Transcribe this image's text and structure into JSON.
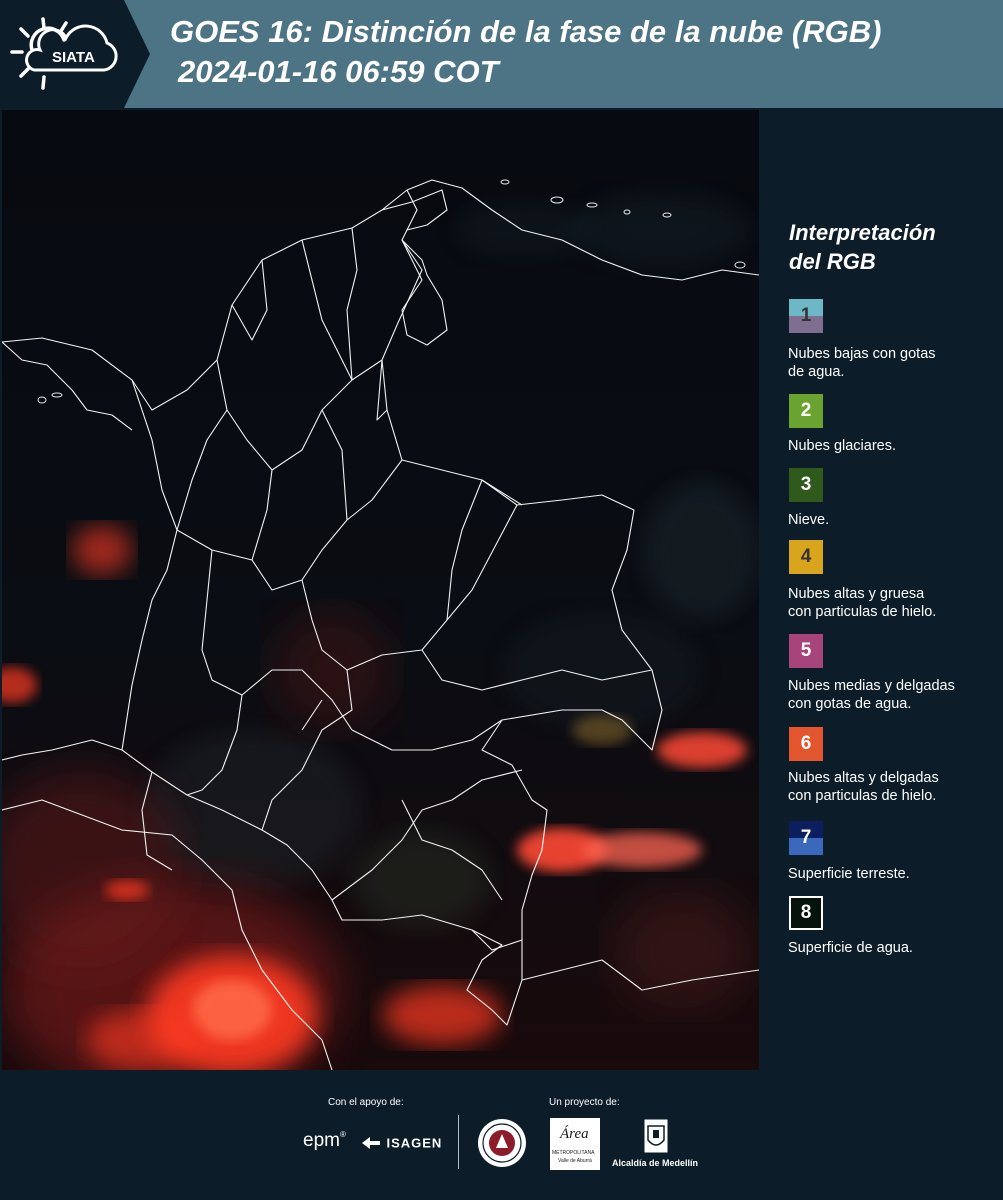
{
  "header": {
    "logo_text": "SIATA",
    "title_line1": "GOES 16: Distinción de la fase de la nube (RGB)",
    "title_line2": "2024-01-16 06:59 COT"
  },
  "legend": {
    "title_line1": "Interpretación",
    "title_line2": "del RGB",
    "items": [
      {
        "number": "1",
        "color_top": "#6cb8c6",
        "color_bottom": "#7e6e90",
        "text_line1": "Nubes bajas con gotas",
        "text_line2": "de agua."
      },
      {
        "number": "2",
        "color": "#6aa330",
        "text_line1": "Nubes glaciares.",
        "text_line2": ""
      },
      {
        "number": "3",
        "color": "#2f5a1c",
        "text_line1": "Nieve.",
        "text_line2": ""
      },
      {
        "number": "4",
        "color": "#d9a51d",
        "text_line1": "Nubes altas y gruesa",
        "text_line2": "con particulas de hielo."
      },
      {
        "number": "5",
        "color": "#a7447b",
        "text_line1": "Nubes medias y delgadas",
        "text_line2": "con gotas de agua."
      },
      {
        "number": "6",
        "color": "#e3552c",
        "text_line1": "Nubes altas y delgadas",
        "text_line2": "con particulas de hielo."
      },
      {
        "number": "7",
        "color_top": "#0c1e5e",
        "color_bottom": "#3a68bd",
        "text_line1": "Superficie terreste.",
        "text_line2": ""
      },
      {
        "number": "8",
        "color": "#06130c",
        "text_line1": "Superficie de agua.",
        "text_line2": ""
      }
    ]
  },
  "footer": {
    "support_label": "Con el apoyo de:",
    "project_label": "Un proyecto de:",
    "epm_text": "epm",
    "isagen_text": "ISAGEN",
    "area_text": "Área",
    "area_sub1": "METROPOLITANA",
    "area_sub2": "Valle de Aburrá",
    "alcaldia_text": "Alcaldía de Medellín"
  },
  "colors": {
    "header_bg": "#4d7484",
    "logo_bg": "#0c1d29",
    "page_bg": "#0c1d29",
    "cloud_red": "#ff3b24",
    "border_white": "#ffffff"
  },
  "icons": [
    "siata-sun-cloud-logo-icon",
    "epm-logo-icon",
    "isagen-logo-icon",
    "university-seal-icon",
    "area-metropolitana-logo-icon",
    "alcaldia-medellin-shield-icon"
  ]
}
